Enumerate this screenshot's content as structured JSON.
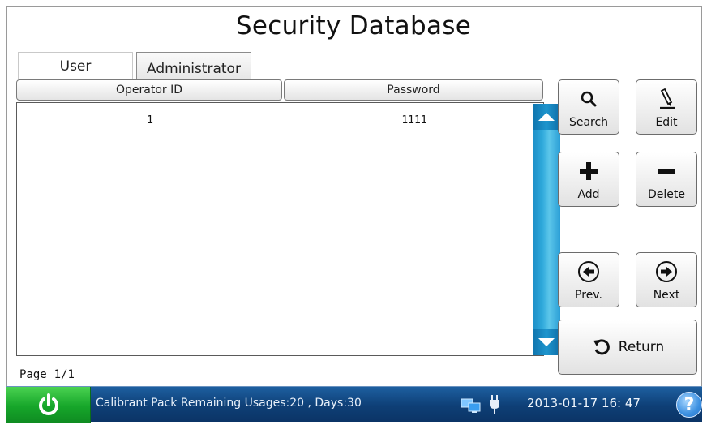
{
  "title": "Security Database",
  "tabs": [
    {
      "label": "User"
    },
    {
      "label": "Administrator"
    }
  ],
  "table": {
    "columns": [
      "Operator ID",
      "Password"
    ],
    "rows": [
      {
        "operator_id": "1",
        "password": "1111"
      }
    ]
  },
  "buttons": {
    "search": "Search",
    "edit": "Edit",
    "add": "Add",
    "delete": "Delete",
    "prev": "Prev.",
    "next": "Next",
    "return": "Return"
  },
  "page_indicator": {
    "label": "Page",
    "value": "1/1"
  },
  "status_bar": {
    "message": "Calibrant Pack Remaining Usages:20 , Days:30",
    "datetime": "2013-01-17  16: 47",
    "help_glyph": "?"
  },
  "colors": {
    "status_bar": "#0e3f76",
    "power_button": "#16a62a",
    "scrollbar": "#2fa9db"
  },
  "icons": [
    "search-icon",
    "edit-pencil-icon",
    "plus-icon",
    "minus-icon",
    "arrow-left-icon",
    "arrow-right-icon",
    "return-icon",
    "power-icon",
    "network-icon",
    "power-plug-icon",
    "help-icon"
  ]
}
